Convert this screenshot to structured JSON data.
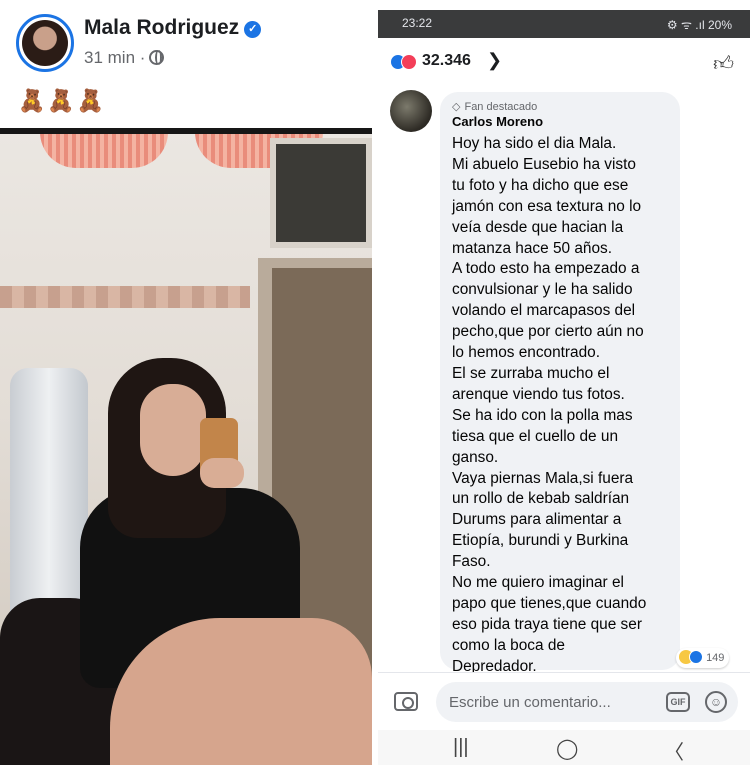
{
  "post": {
    "author": "Mala Rodriguez",
    "verified_icon": "verified-badge-icon",
    "time": "31 min ·",
    "privacy_icon": "globe-icon",
    "caption": "🧸🧸🧸"
  },
  "phone": {
    "status_time": "23:22",
    "status_right": "⚙ ᯤ .ıl 20%",
    "reaction_count": "32.346",
    "reaction_chevron": "❯",
    "like_icon": "thumbs-up-icon"
  },
  "comment": {
    "badge": "Fan destacado",
    "name": "Carlos Moreno",
    "lines": [
      "Hoy ha sido el dia Mala.",
      "Mi abuelo Eusebio ha visto",
      "tu foto y ha dicho que ese",
      "jamón con esa textura no lo",
      "veía desde que hacian la",
      "matanza hace 50 años.",
      "A todo esto ha empezado a",
      "convulsionar y le ha salido",
      "volando el marcapasos del",
      "pecho,que por cierto aún no",
      "lo hemos encontrado.",
      "El se zurraba mucho el",
      "arenque viendo tus fotos.",
      "Se ha ido con la polla mas",
      "tiesa que el cuello de un",
      "ganso.",
      "Vaya piernas Mala,si fuera",
      "un rollo de kebab saldrían",
      "Durums para alimentar a",
      "Etiopía, burundi y Burkina",
      "Faso.",
      "No me quiero imaginar el",
      "papo que tienes,que  cuando",
      "eso pida traya tiene que ser",
      "como la boca de",
      "Depredador."
    ],
    "reaction_count": "149"
  },
  "composer": {
    "placeholder": "Escribe un comentario...",
    "gif_label": "GIF",
    "emoji_label": "☺"
  },
  "navbar": {
    "recents": "|||",
    "home": "◯",
    "back": "〈"
  }
}
